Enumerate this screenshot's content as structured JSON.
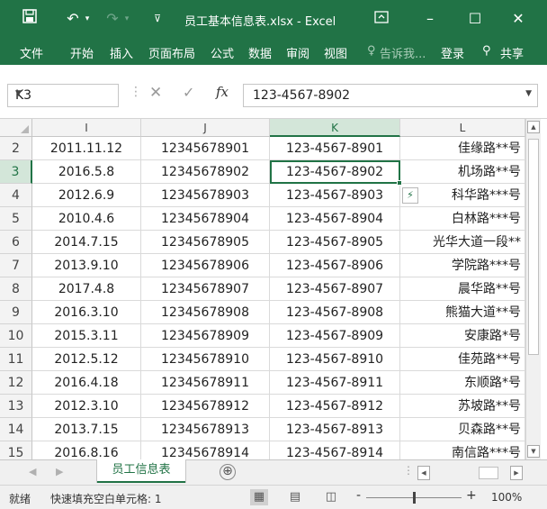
{
  "window": {
    "title": "员工基本信息表.xlsx - Excel",
    "save_icon": "floppy-disk-icon",
    "undo_icon": "undo-icon",
    "redo_icon": "redo-icon",
    "minimize": "–",
    "maximize": "☐",
    "close": "✕",
    "accent": "#217346"
  },
  "ribbon": {
    "tabs": [
      "文件",
      "开始",
      "插入",
      "页面布局",
      "公式",
      "数据",
      "审阅",
      "视图"
    ],
    "tell_me": "告诉我...",
    "login": "登录",
    "share": "共享"
  },
  "formula_bar": {
    "name_box": "K3",
    "cancel": "✕",
    "enter": "✓",
    "fx": "fx",
    "value": "123-4567-8902"
  },
  "grid": {
    "columns": [
      "I",
      "J",
      "K",
      "L"
    ],
    "selected_column": "K",
    "selected_row": "3",
    "rows": [
      {
        "row": "2",
        "i": "2011.11.12",
        "j": "12345678901",
        "k": "123-4567-8901",
        "l": "佳缘路**号"
      },
      {
        "row": "3",
        "i": "2016.5.8",
        "j": "12345678902",
        "k": "123-4567-8902",
        "l": "机场路**号"
      },
      {
        "row": "4",
        "i": "2012.6.9",
        "j": "12345678903",
        "k": "123-4567-8903",
        "l": "科华路***号"
      },
      {
        "row": "5",
        "i": "2010.4.6",
        "j": "12345678904",
        "k": "123-4567-8904",
        "l": "白林路***号"
      },
      {
        "row": "6",
        "i": "2014.7.15",
        "j": "12345678905",
        "k": "123-4567-8905",
        "l": "光华大道一段**"
      },
      {
        "row": "7",
        "i": "2013.9.10",
        "j": "12345678906",
        "k": "123-4567-8906",
        "l": "学院路***号"
      },
      {
        "row": "8",
        "i": "2017.4.8",
        "j": "12345678907",
        "k": "123-4567-8907",
        "l": "晨华路**号"
      },
      {
        "row": "9",
        "i": "2016.3.10",
        "j": "12345678908",
        "k": "123-4567-8908",
        "l": "熊猫大道**号"
      },
      {
        "row": "10",
        "i": "2015.3.11",
        "j": "12345678909",
        "k": "123-4567-8909",
        "l": "安康路*号"
      },
      {
        "row": "11",
        "i": "2012.5.12",
        "j": "12345678910",
        "k": "123-4567-8910",
        "l": "佳苑路**号"
      },
      {
        "row": "12",
        "i": "2016.4.18",
        "j": "12345678911",
        "k": "123-4567-8911",
        "l": "东顺路*号"
      },
      {
        "row": "13",
        "i": "2012.3.10",
        "j": "12345678912",
        "k": "123-4567-8912",
        "l": "苏坡路**号"
      },
      {
        "row": "14",
        "i": "2013.7.15",
        "j": "12345678913",
        "k": "123-4567-8913",
        "l": "贝森路**号"
      },
      {
        "row": "15",
        "i": "2016.8.16",
        "j": "12345678914",
        "k": "123-4567-8914",
        "l": "南信路***号"
      }
    ]
  },
  "sheets": {
    "active": "员工信息表",
    "add": "⊕"
  },
  "status": {
    "ready": "就绪",
    "message": "快速填充空白单元格: 1",
    "zoom": "100%",
    "zoom_minus": "-",
    "zoom_plus": "+"
  }
}
